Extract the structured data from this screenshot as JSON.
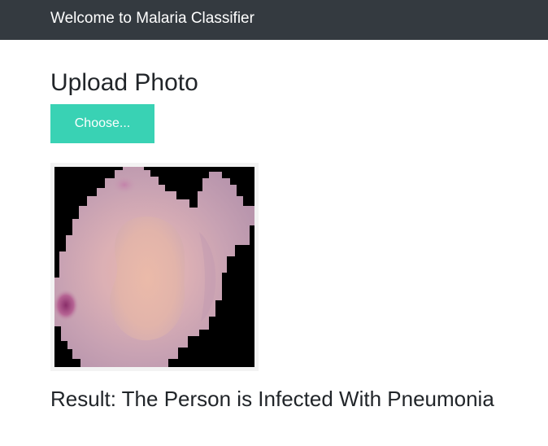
{
  "navbar": {
    "brand": "Welcome to Malaria Classifier"
  },
  "upload": {
    "title": "Upload Photo",
    "button_label": "Choose..."
  },
  "preview": {
    "image_name": "cell-image",
    "subject": "stained blood cell micrograph"
  },
  "result": {
    "text": "Result: The Person is Infected With Pneumonia"
  },
  "colors": {
    "navbar_bg": "#343a40",
    "button_bg": "#39d2b4",
    "text": "#212529"
  }
}
